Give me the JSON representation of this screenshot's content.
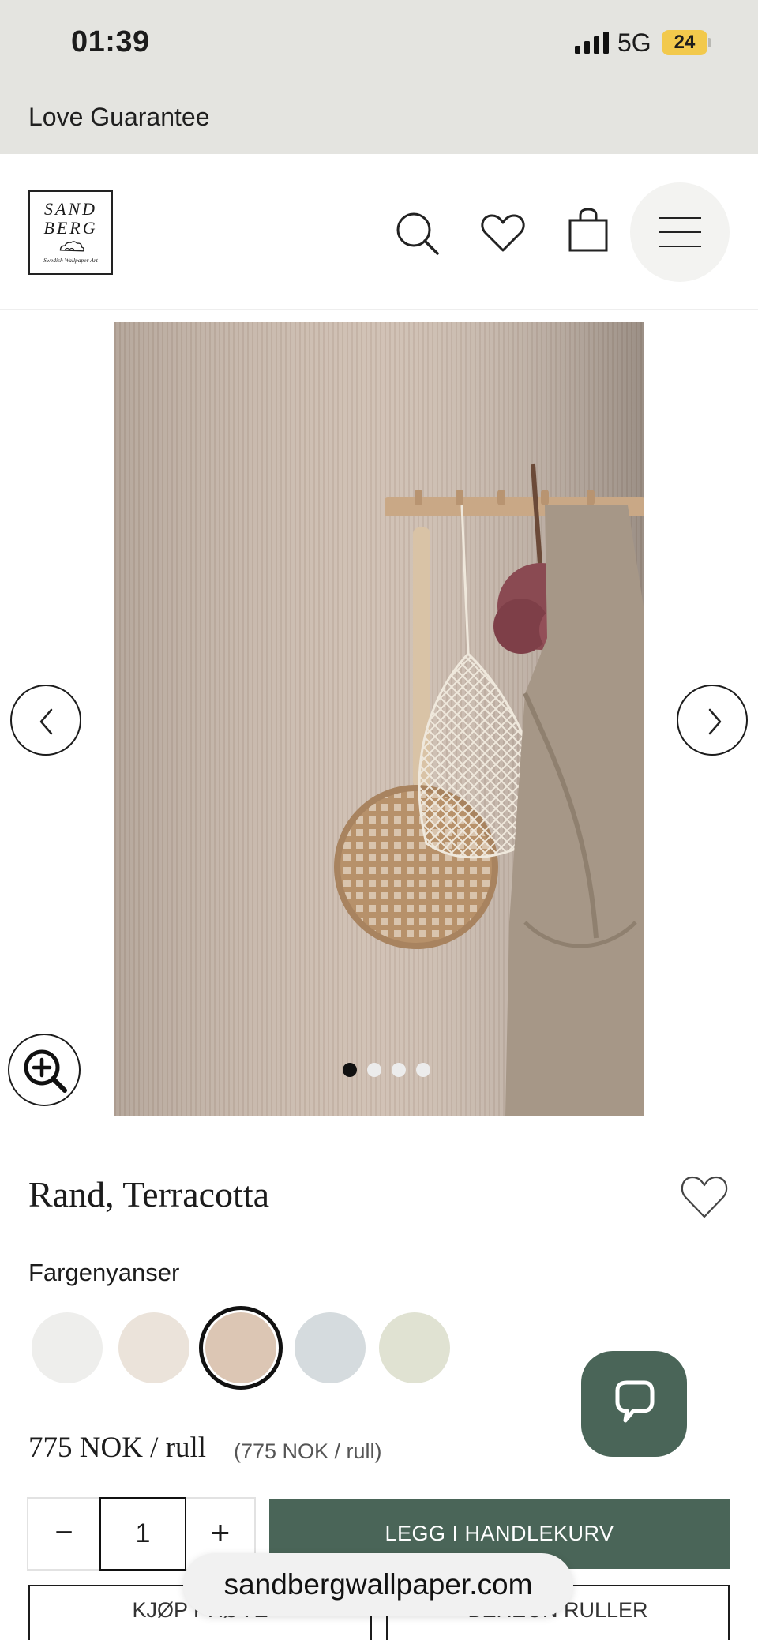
{
  "status_bar": {
    "time": "01:39",
    "network": "5G",
    "battery": "24",
    "battery_color": "#f2c94c"
  },
  "promo_banner": {
    "text": "Love Guarantee"
  },
  "header": {
    "logo": {
      "line1": "SAND",
      "line2": "BERG",
      "tagline": "Swedish Wallpaper Art"
    },
    "icons": [
      "search-icon",
      "heart-icon",
      "bag-icon",
      "menu-icon"
    ]
  },
  "gallery": {
    "slide_count": 4,
    "active_slide": 1
  },
  "product": {
    "title": "Rand, Terracotta",
    "shades_label": "Fargenyanser",
    "swatches": [
      {
        "color": "#eeeeec",
        "selected": false
      },
      {
        "color": "#ebe3da",
        "selected": false
      },
      {
        "color": "#dcc6b4",
        "selected": true
      },
      {
        "color": "#d5dbde",
        "selected": false
      },
      {
        "color": "#e0e2d2",
        "selected": false
      }
    ],
    "price": "775 NOK / rull",
    "price_sub": "(775 NOK / rull)"
  },
  "purchase": {
    "qty_minus": "−",
    "quantity": "1",
    "qty_plus": "+",
    "add_to_cart": "LEGG I HANDLEKURV",
    "buy_sample": "KJØP PRØVE",
    "calculate_rolls": "BEREGN RULLER"
  },
  "browser": {
    "url": "sandbergwallpaper.com"
  },
  "colors": {
    "brand_green": "#4a6558",
    "banner_bg": "#e4e4e0"
  }
}
